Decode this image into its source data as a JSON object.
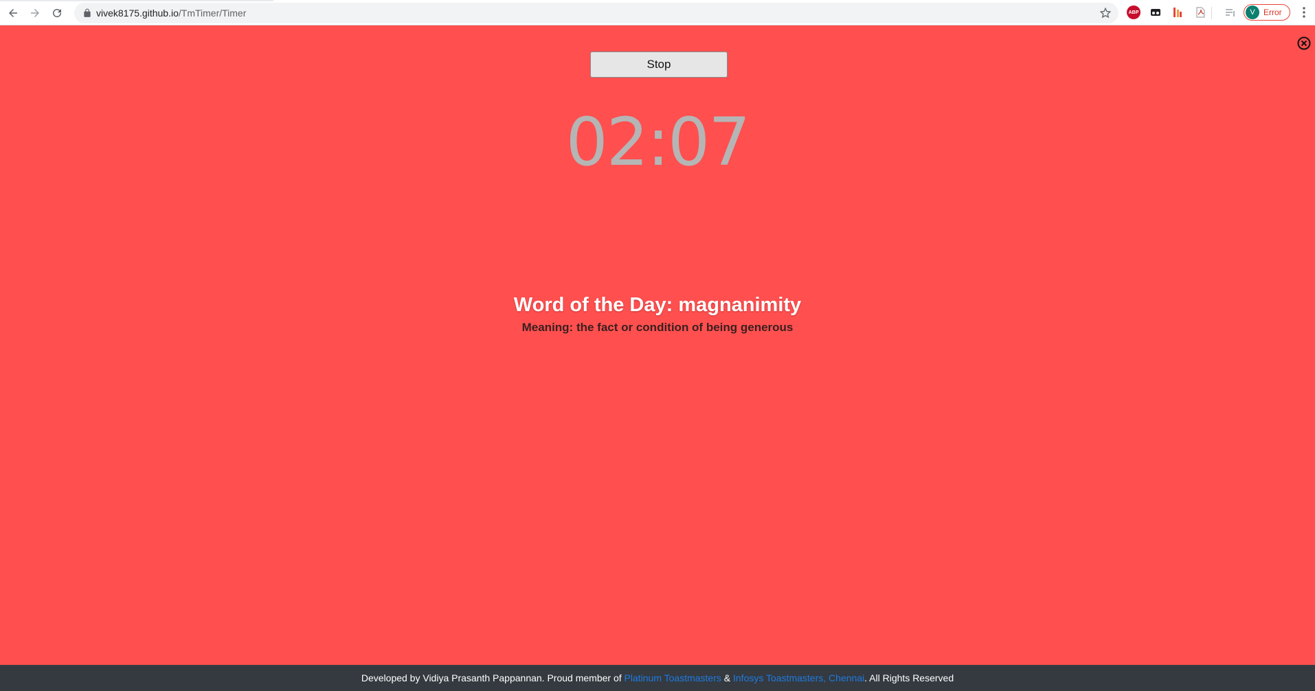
{
  "browser": {
    "url_host": "vivek8175.github.io",
    "url_path": "/TmTimer/Timer",
    "profile_initial": "V",
    "profile_label": "Error",
    "extensions": [
      "adblock-plus-icon",
      "incognito-mask-icon",
      "app-extension-icon",
      "pdf-icon",
      "reading-queue-icon"
    ],
    "abp_text": "ABP"
  },
  "page": {
    "background_color": "#ff4f4f",
    "stop_button_label": "Stop",
    "timer_display": "02:07",
    "word_of_day": "Word of the Day: magnanimity",
    "meaning": "Meaning: the fact or condition of being generous"
  },
  "footer": {
    "text_before": "Developed by Vidiya Prasanth Pappannan. Proud member of ",
    "link1": "Platinum Toastmasters",
    "text_between": " & ",
    "link2": "Infosys Toastmasters, Chennai",
    "text_after": ". All Rights Reserved"
  },
  "colors": {
    "accent_link": "#1f7ae0",
    "footer_bg": "#343a40",
    "timer_text": "#b5b5b5"
  }
}
